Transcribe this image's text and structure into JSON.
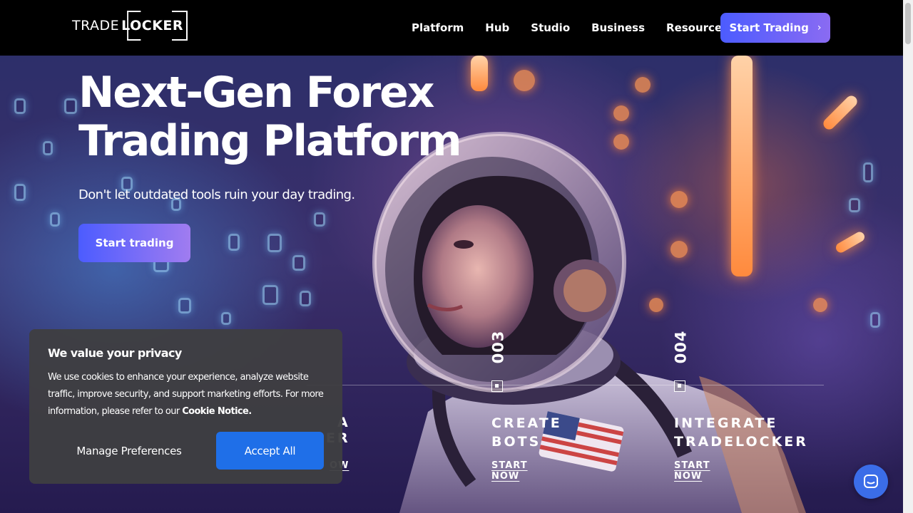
{
  "nav": {
    "logo_trade": "TRADE",
    "logo_locker": "LOCKER",
    "links": [
      {
        "label": "Platform"
      },
      {
        "label": "Hub"
      },
      {
        "label": "Studio"
      },
      {
        "label": "Business"
      },
      {
        "label": "Resources"
      }
    ],
    "cta_label": "Start Trading",
    "cta_icon": "chevron-right-icon"
  },
  "hero": {
    "title_line1": "Next-Gen Forex",
    "title_line2": "Trading Platform",
    "subtitle": "Don't let outdated tools ruin your day trading.",
    "button_label": "Start trading"
  },
  "steps": [
    {
      "number": "003",
      "title_line1": "CREATE",
      "title_line2": "BOTS",
      "link": "START NOW"
    },
    {
      "number": "004",
      "title_line1": "INTEGRATE",
      "title_line2": "TRADELOCKER",
      "link": "START NOW"
    }
  ],
  "partial_step": {
    "line1": "A",
    "line2": "ER",
    "link": "OW"
  },
  "cookie": {
    "title": "We value your privacy",
    "body": "We use cookies to enhance your experience, analyze website traffic, improve security, and support marketing efforts. For more information, please refer to our",
    "notice_link": "Cookie Notice.",
    "manage_label": "Manage Preferences",
    "accept_label": "Accept All"
  },
  "chat": {
    "icon": "chat-bubble-icon"
  },
  "colors": {
    "accent_start": "#4c5cff",
    "accent_end": "#8a6bf2",
    "accept_button": "#1f6fe8",
    "nav_bg": "#000000"
  }
}
